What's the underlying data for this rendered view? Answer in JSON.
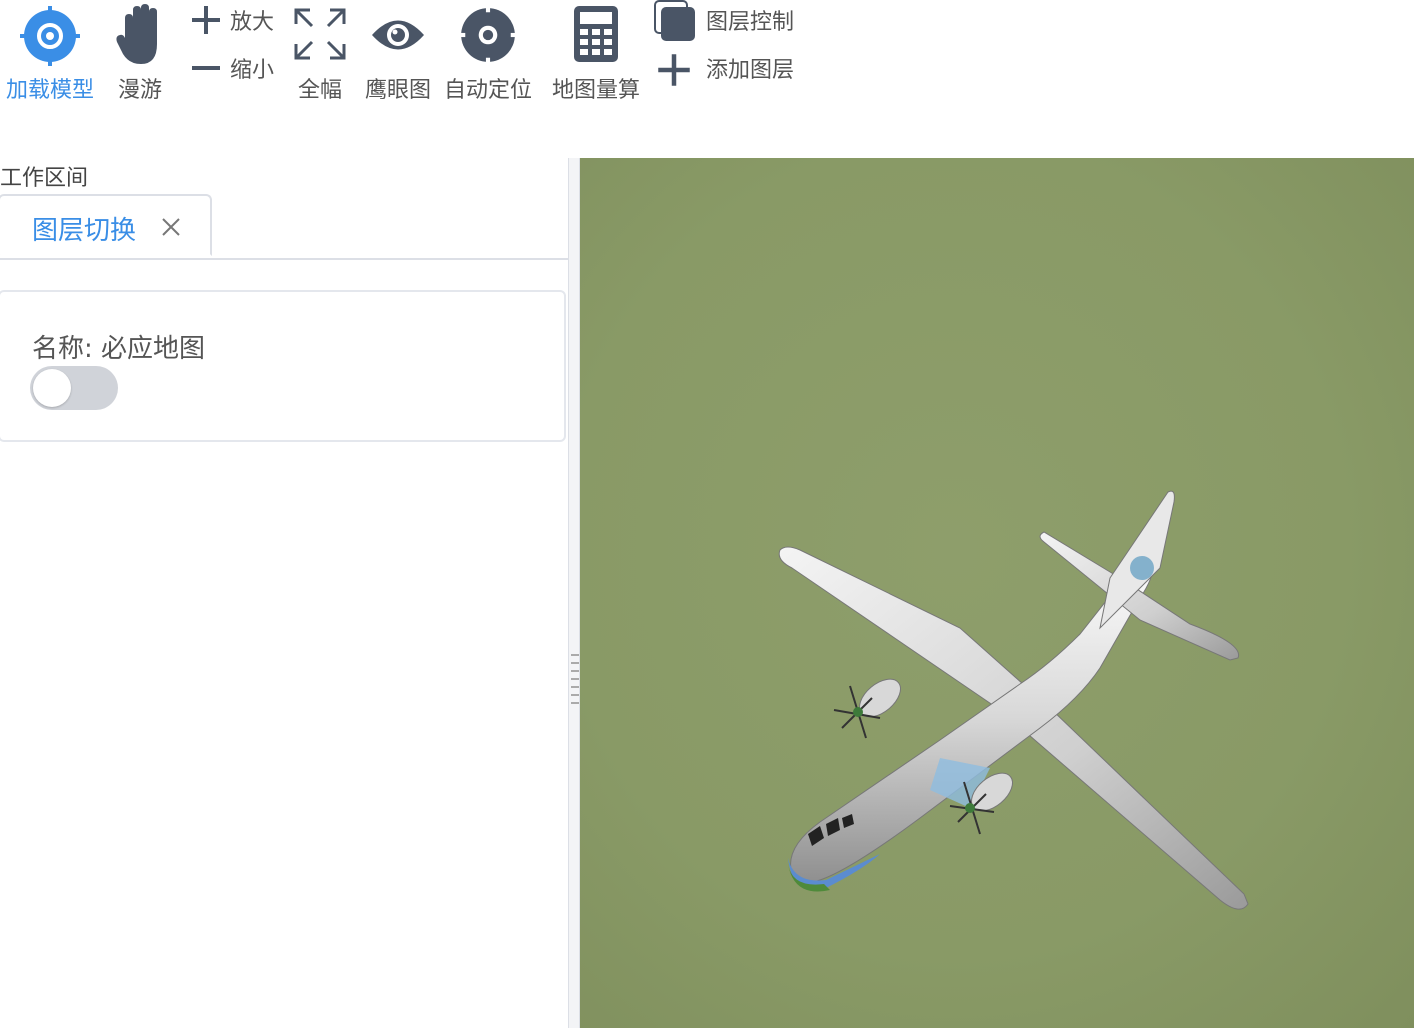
{
  "toolbar": {
    "load_model": "加载模型",
    "roam": "漫游",
    "zoom_in": "放大",
    "zoom_out": "缩小",
    "full_extent": "全幅",
    "eagle_eye": "鹰眼图",
    "auto_locate": "自动定位",
    "map_measure": "地图量算",
    "layer_control": "图层控制",
    "add_layer": "添加图层"
  },
  "workspace": {
    "title": "工作区间",
    "tab_label": "图层切换",
    "layer_name": "名称: 必应地图",
    "layer_visible": false
  },
  "colors": {
    "accent": "#3a8ee6",
    "icon": "#4a5566",
    "ground": "#899a66"
  }
}
